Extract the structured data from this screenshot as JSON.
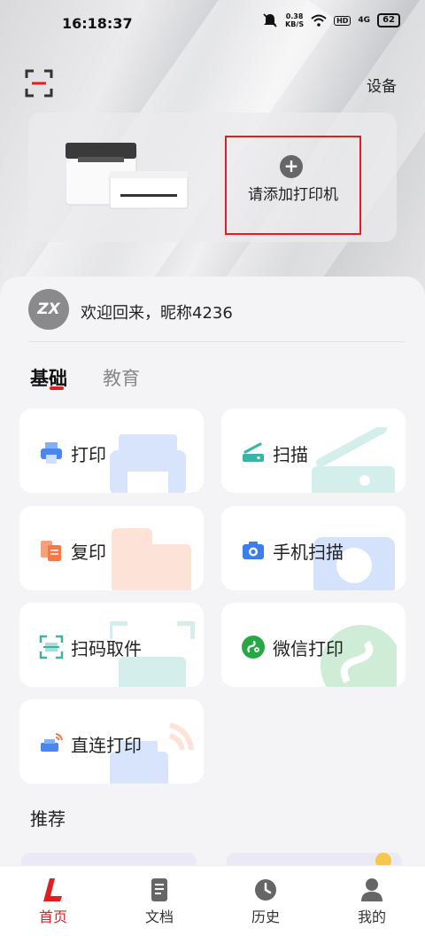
{
  "status_bar": {
    "time": "16:18:37",
    "net_speed_value": "0.38",
    "net_speed_unit": "KB/S",
    "hd": "HD",
    "signal": "4G",
    "battery": "62"
  },
  "header": {
    "settings_label": "设备"
  },
  "printer_card": {
    "add_printer_label": "请添加打印机",
    "add_symbol": "+"
  },
  "welcome": {
    "avatar_text": "ZX",
    "text": "欢迎回来，昵称4236"
  },
  "tabs": [
    {
      "label": "基础",
      "active": true
    },
    {
      "label": "教育",
      "active": false
    }
  ],
  "features": [
    {
      "label": "打印",
      "icon": "printer-icon",
      "color": "#4a86f0"
    },
    {
      "label": "扫描",
      "icon": "scanner-icon",
      "color": "#3bb3a5"
    },
    {
      "label": "复印",
      "icon": "copy-icon",
      "color": "#f07a4a"
    },
    {
      "label": "手机扫描",
      "icon": "camera-icon",
      "color": "#3c7df0"
    },
    {
      "label": "扫码取件",
      "icon": "qr-scan-icon",
      "color": "#3bb3a5"
    },
    {
      "label": "微信打印",
      "icon": "wechat-icon",
      "color": "#28a745"
    },
    {
      "label": "直连打印",
      "icon": "wireless-printer-icon",
      "color": "#4a86f0"
    }
  ],
  "section": {
    "recommend_title": "推荐"
  },
  "bottom_nav": [
    {
      "label": "首页",
      "icon": "home-logo-icon",
      "active": true
    },
    {
      "label": "文档",
      "icon": "document-icon",
      "active": false
    },
    {
      "label": "历史",
      "icon": "clock-icon",
      "active": false
    },
    {
      "label": "我的",
      "icon": "profile-icon",
      "active": false
    }
  ],
  "colors": {
    "accent": "#e02020"
  }
}
